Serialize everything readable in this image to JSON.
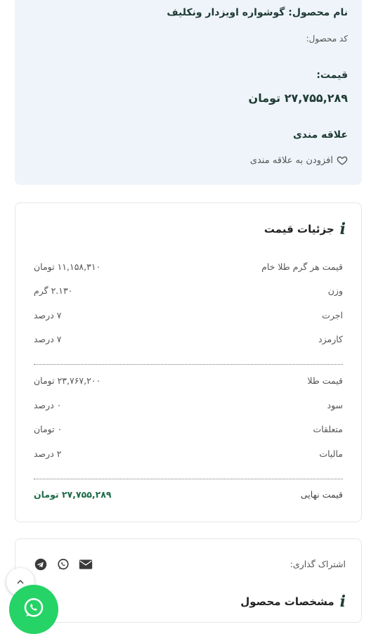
{
  "summary": {
    "name": "نام محصول: گوشواره اویزدار ونکلیف",
    "code": "کد محصول:",
    "price_label": "قیمت:",
    "price_value": "۲۷,۷۵۵,۲۸۹ تومان",
    "favorites_label": "علاقه مندی",
    "add_favorite": "افزودن به علاقه مندی"
  },
  "price_details": {
    "title": "جزئیات قیمت",
    "rows_a": [
      {
        "label": "قیمت هر گرم طلا خام",
        "value": "۱۱,۱۵۸,۳۱۰ تومان"
      },
      {
        "label": "وزن",
        "value": "۲.۱۳۰ گرم"
      },
      {
        "label": "اجرت",
        "value": "۷ درصد"
      },
      {
        "label": "کارمزد",
        "value": "۷ درصد"
      }
    ],
    "rows_b": [
      {
        "label": "قیمت طلا",
        "value": "۲۳,۷۶۷,۲۰۰ تومان"
      },
      {
        "label": "سود",
        "value": "۰ درصد"
      },
      {
        "label": "متعلقات",
        "value": "۰ تومان"
      },
      {
        "label": "مالیات",
        "value": "۲ درصد"
      }
    ],
    "final": {
      "label": "قیمت نهایی",
      "value": "۲۷,۷۵۵,۲۸۹ تومان"
    }
  },
  "share": {
    "label": "اشتراک گذاری:",
    "icons": [
      "email-icon",
      "whatsapp-icon",
      "telegram-icon"
    ]
  },
  "specs": {
    "title": "مشخصات محصول"
  },
  "colors": {
    "accent_dark": "#1e3b34",
    "final_price": "#1e6b48",
    "summary_bg": "#eef4f9",
    "whatsapp": "#25d366"
  }
}
